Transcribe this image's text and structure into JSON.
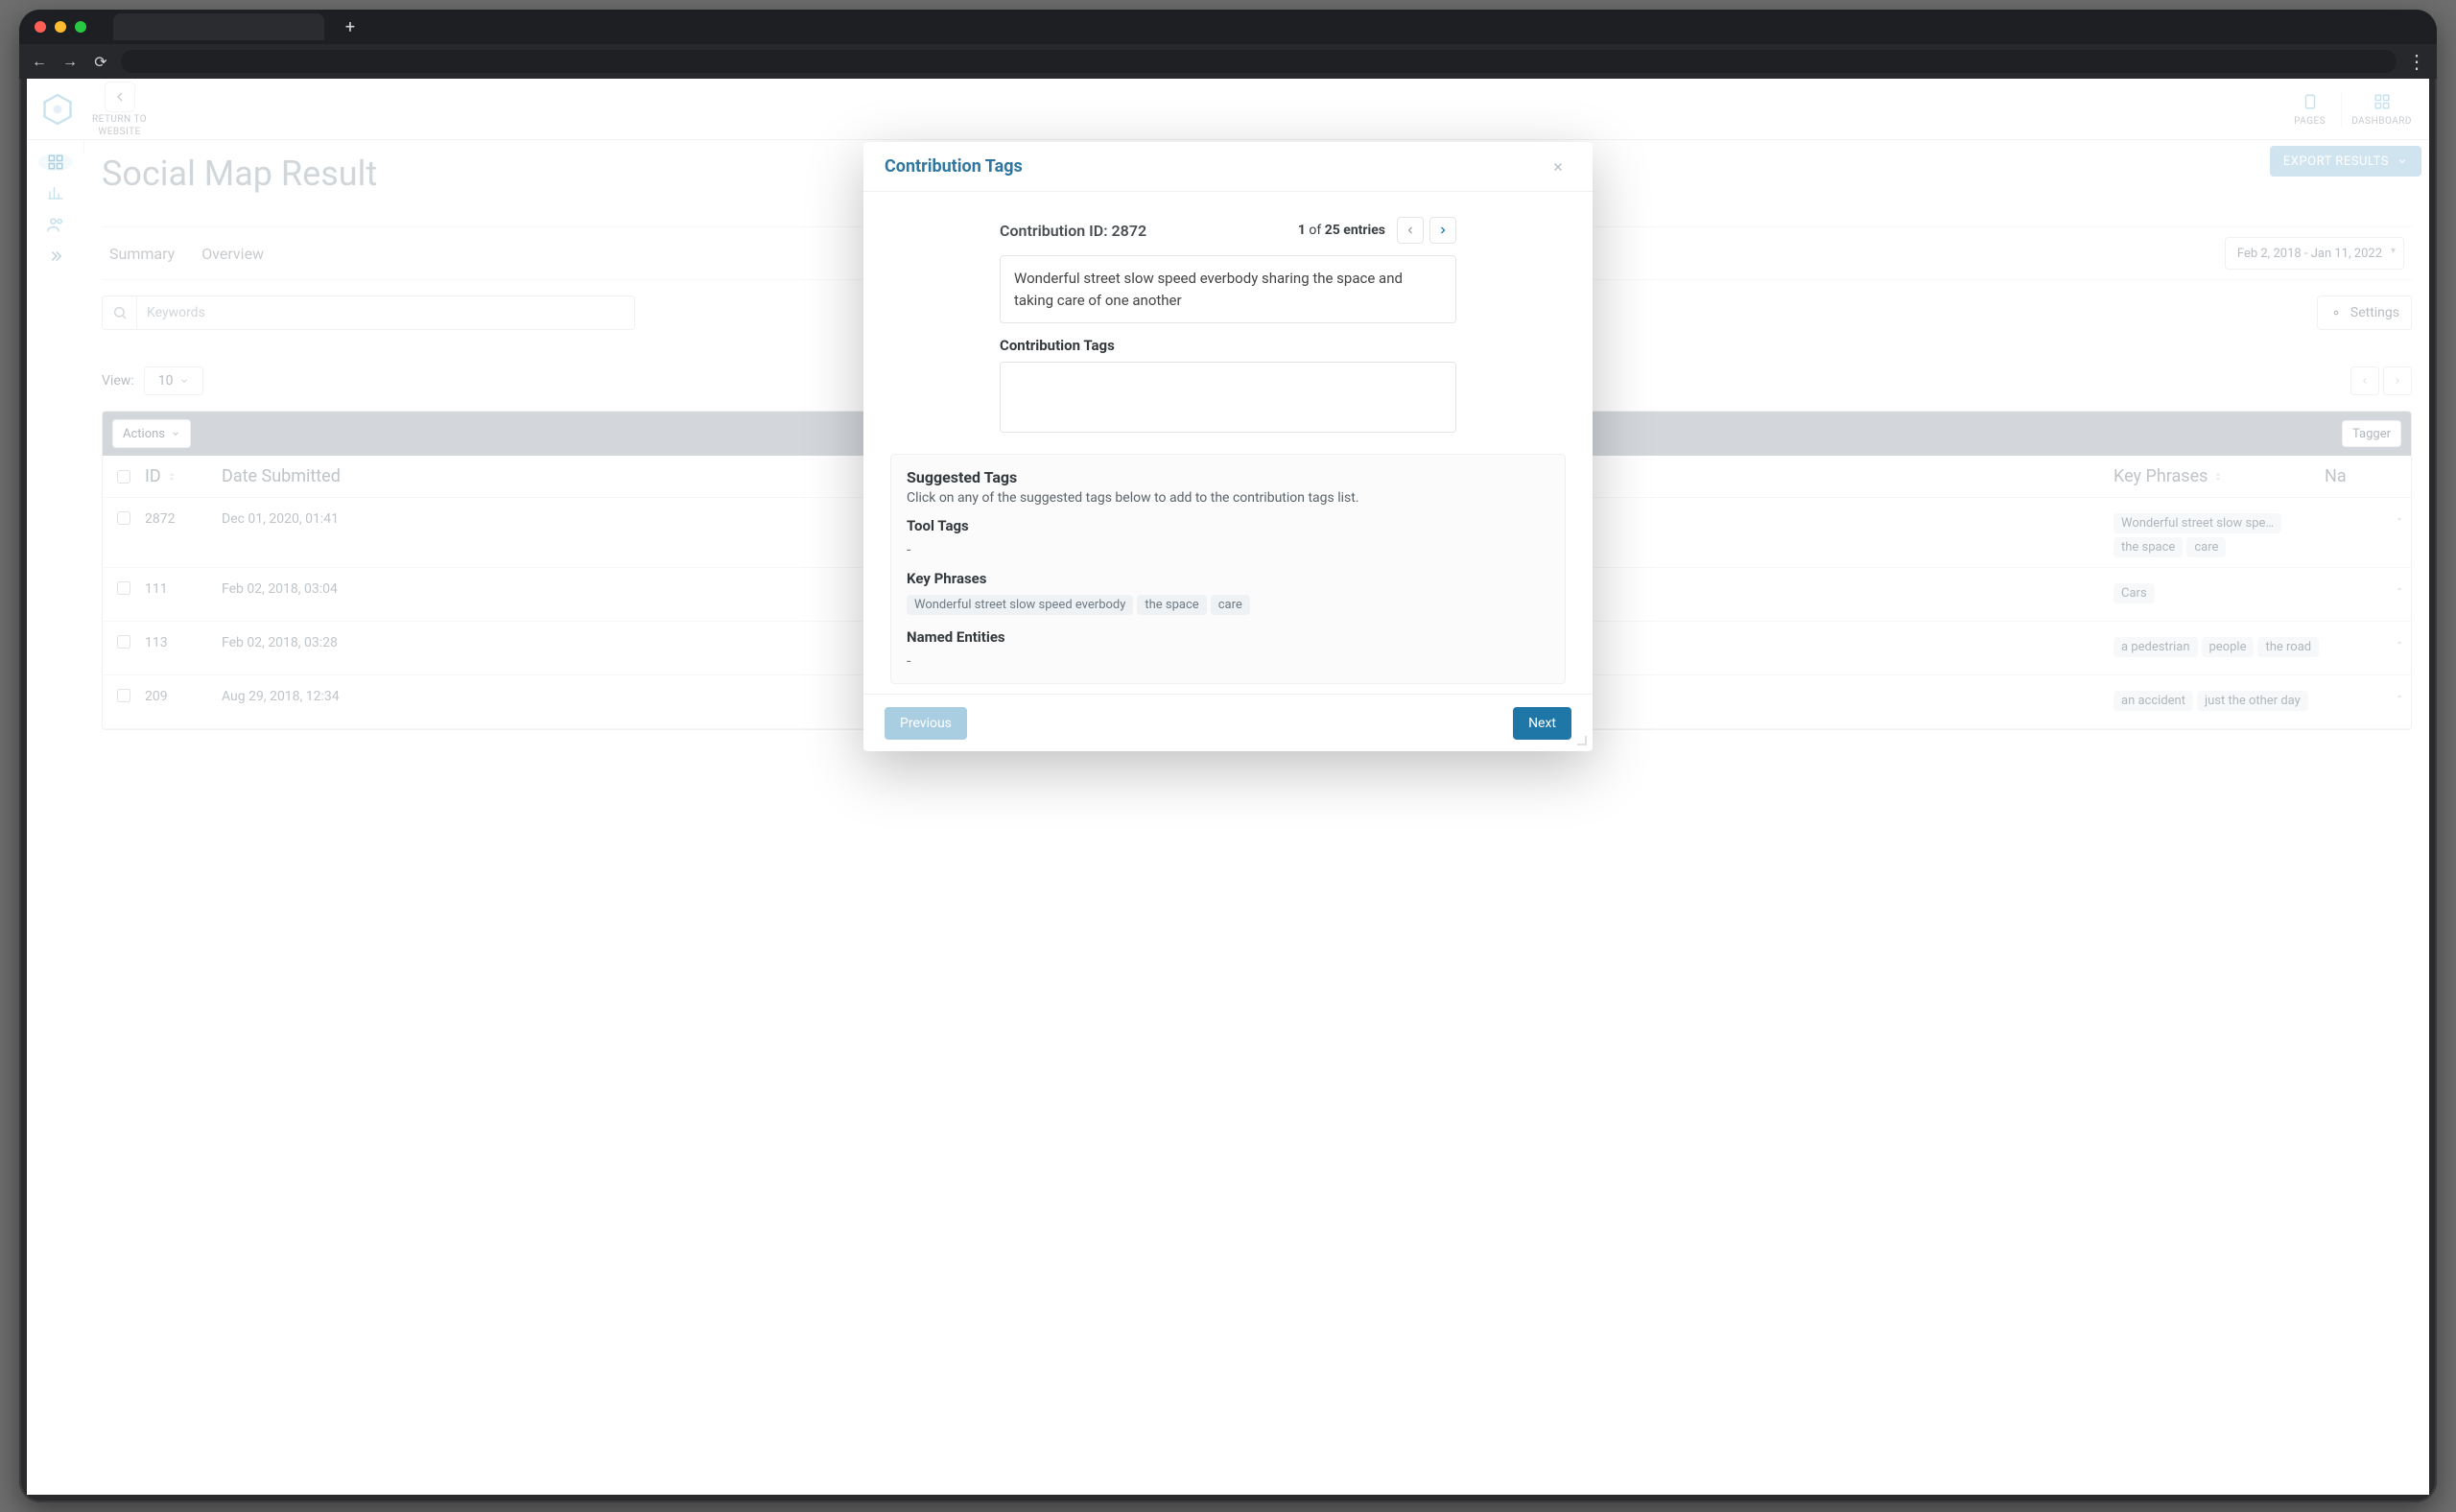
{
  "browser": {
    "new_tab_plus": "+",
    "back": "←",
    "forward": "→",
    "reload": "⟳",
    "menu": "⋮"
  },
  "topbar": {
    "return_label_1": "RETURN TO",
    "return_label_2": "WEBSITE",
    "pages_label": "PAGES",
    "dashboard_label": "DASHBOARD"
  },
  "page": {
    "title": "Social Map Result",
    "export_label": "EXPORT RESULTS",
    "tab_summary": "Summary",
    "tab_overview": "Overview",
    "date_range": "Feb 2, 2018 - Jan 11, 2022",
    "keywords_placeholder": "Keywords",
    "settings_label": "Settings",
    "view_label": "View:",
    "view_value": "10",
    "actions_label": "Actions",
    "tagger_label": "Tagger",
    "col_id": "ID",
    "col_date": "Date Submitted",
    "col_keyphrases": "Key Phrases",
    "col_named_short": "Na"
  },
  "rows": [
    {
      "id": "2872",
      "date": "Dec 01, 2020, 01:41",
      "keyphrases": [
        "Wonderful street slow spe…",
        "the space",
        "care"
      ],
      "named": "-"
    },
    {
      "id": "111",
      "date": "Feb 02, 2018, 03:04",
      "keyphrases": [
        "Cars"
      ],
      "named": "-"
    },
    {
      "id": "113",
      "date": "Feb 02, 2018, 03:28",
      "keyphrases": [
        "a pedestrian",
        "people",
        "the road"
      ],
      "named": "-"
    },
    {
      "id": "209",
      "date": "Aug 29, 2018, 12:34",
      "keyphrases": [
        "an accident",
        "just the other day"
      ],
      "named": "-"
    }
  ],
  "modal": {
    "title": "Contribution Tags",
    "cid_label": "Contribution ID: 2872",
    "entries_current": "1",
    "entries_of": "of",
    "entries_total": "25 entries",
    "desc": "Wonderful street slow speed everbody sharing the space and taking care of one another",
    "tags_label": "Contribution Tags",
    "suggested_title": "Suggested Tags",
    "suggested_sub": "Click on any of the suggested tags below to add to the contribution tags list.",
    "tool_title": "Tool Tags",
    "tool_value": "-",
    "kp_title": "Key Phrases",
    "kp_tags": [
      "Wonderful street slow speed everbody",
      "the space",
      "care"
    ],
    "ne_title": "Named Entities",
    "ne_value": "-",
    "btn_prev": "Previous",
    "btn_next": "Next"
  }
}
